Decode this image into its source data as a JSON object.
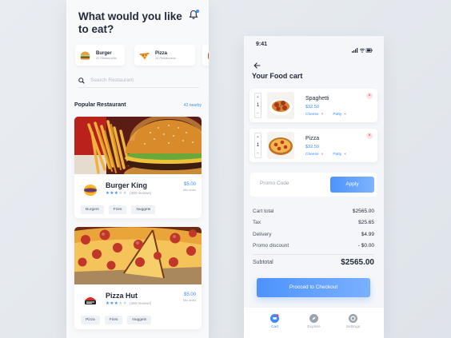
{
  "left": {
    "heading": "What would you like to eat?",
    "categories": [
      {
        "name": "Burger",
        "sub": "42 Restaurants",
        "icon": "burger-icon"
      },
      {
        "name": "Pizza",
        "sub": "18 Restaurants",
        "icon": "pizza-icon"
      }
    ],
    "search": {
      "placeholder": "Search Restaurant"
    },
    "section": {
      "title": "Popular Restaurant",
      "link": "42 nearby"
    },
    "restaurants": [
      {
        "name": "Burger King",
        "price": "$5.00",
        "min": "Min order",
        "reviews": "(380 reviews)",
        "rating": 4,
        "tags": [
          "Burgers",
          "Fries",
          "Nuggets"
        ]
      },
      {
        "name": "Pizza Hut",
        "price": "$5.00",
        "min": "Min order",
        "reviews": "(260 reviews)",
        "rating": 4,
        "tags": [
          "Pizza",
          "Fries",
          "Nuggets"
        ]
      }
    ]
  },
  "right": {
    "time": "9:41",
    "title": "Your Food cart",
    "items": [
      {
        "name": "Spaghetti",
        "price": "$32.50",
        "qty": "1",
        "plus": "+",
        "minus": "−",
        "opts": [
          "Cheese",
          "Patty"
        ],
        "remove": "×"
      },
      {
        "name": "Pizza",
        "price": "$32.50",
        "qty": "1",
        "plus": "+",
        "minus": "−",
        "opts": [
          "Cheese",
          "Patty"
        ],
        "remove": "×"
      }
    ],
    "promo": {
      "placeholder": "Promo Code",
      "apply": "Apply"
    },
    "totals": [
      {
        "label": "Cart total",
        "value": "$2565.00"
      },
      {
        "label": "Tax",
        "value": "$25.65"
      },
      {
        "label": "Delivery",
        "value": "$4.99"
      },
      {
        "label": "Promo discount",
        "value": "- $0.00"
      }
    ],
    "subtotal": {
      "label": "Subtotal",
      "value": "$2565.00"
    },
    "checkout": "Procced to Checkout",
    "tabs": [
      {
        "label": "Cart",
        "icon": "cart-icon"
      },
      {
        "label": "Explore",
        "icon": "compass-icon"
      },
      {
        "label": "Settings",
        "icon": "gear-icon"
      }
    ]
  },
  "colors": {
    "accent": "#3d8bfd",
    "danger": "#e0485a",
    "text": "#232a3a"
  }
}
